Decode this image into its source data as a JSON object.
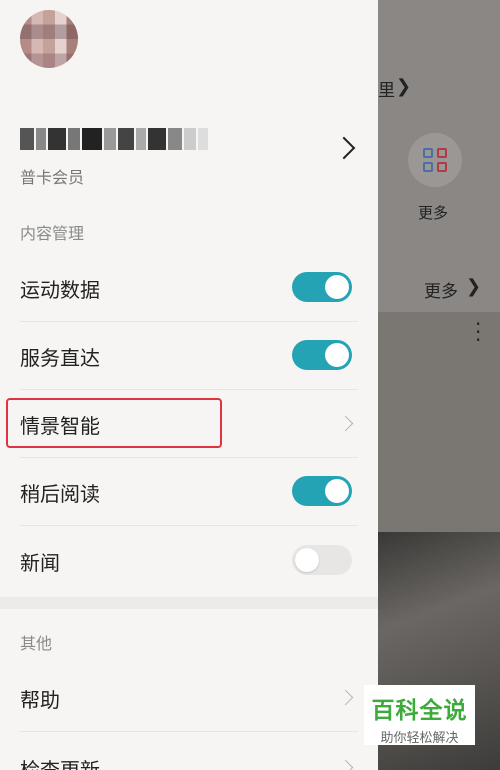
{
  "background": {
    "fragment_text": "里",
    "more_label": "更多",
    "more_link": "更多"
  },
  "profile": {
    "membership": "普卡会员"
  },
  "sections": {
    "content_management": "内容管理",
    "other": "其他"
  },
  "items": [
    {
      "label": "运动数据",
      "control": "toggle",
      "on": true
    },
    {
      "label": "服务直达",
      "control": "toggle",
      "on": true
    },
    {
      "label": "情景智能",
      "control": "chevron"
    },
    {
      "label": "稍后阅读",
      "control": "toggle",
      "on": true
    },
    {
      "label": "新闻",
      "control": "toggle",
      "on": false
    }
  ],
  "other_items": [
    {
      "label": "帮助",
      "control": "chevron"
    },
    {
      "label": "检查更新",
      "control": "chevron"
    }
  ],
  "colors": {
    "accent": "#23a3b4",
    "highlight": "#e0323f",
    "watermark_green": "#3eaa3b"
  },
  "watermark": {
    "title": "百科全说",
    "subtitle": "助你轻松解决"
  }
}
